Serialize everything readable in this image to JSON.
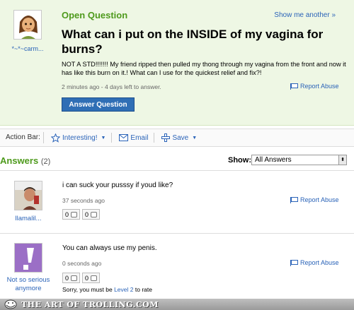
{
  "question": {
    "status": "Open Question",
    "show_another": "Show me another »",
    "title": "What can i put on the INSIDE of my vagina for burns?",
    "body": "NOT A STD!!!!!!! My friend ripped then pulled my thong through my vagina from the front and now it has like this burn on it.! What can I use for the quickest relief and fix?!",
    "meta": "2 minutes ago - 4 days left to answer.",
    "report": "Report Abuse",
    "answer_button": "Answer Question",
    "asker": "*~*~carm..."
  },
  "action_bar": {
    "label": "Action Bar:",
    "interesting": "Interesting!",
    "email": "Email",
    "save": "Save"
  },
  "answers": {
    "heading": "Answers",
    "count": "(2)",
    "show_label": "Show:",
    "filter_value": "All Answers",
    "items": [
      {
        "user": "llamalil...",
        "text": "i can suck your pusssy if youd like?",
        "time": "37 seconds ago",
        "report": "Report Abuse",
        "thumbs_up": "0",
        "thumbs_down": "0"
      },
      {
        "user": "Not so serious anymore",
        "text": "You can always use my penis.",
        "time": "0 seconds ago",
        "report": "Report Abuse",
        "thumbs_up": "0",
        "thumbs_down": "0",
        "rate_note": "Sorry, you must be",
        "rate_link": "Level 2",
        "rate_note_end": "to rate"
      }
    ]
  },
  "watermark": "THE ART OF TROLLING.COM",
  "colors": {
    "question_bg": "#eef7e4",
    "status_green": "#4e9a1c",
    "link_blue": "#2a63b8",
    "button_blue": "#2f6eb5"
  }
}
